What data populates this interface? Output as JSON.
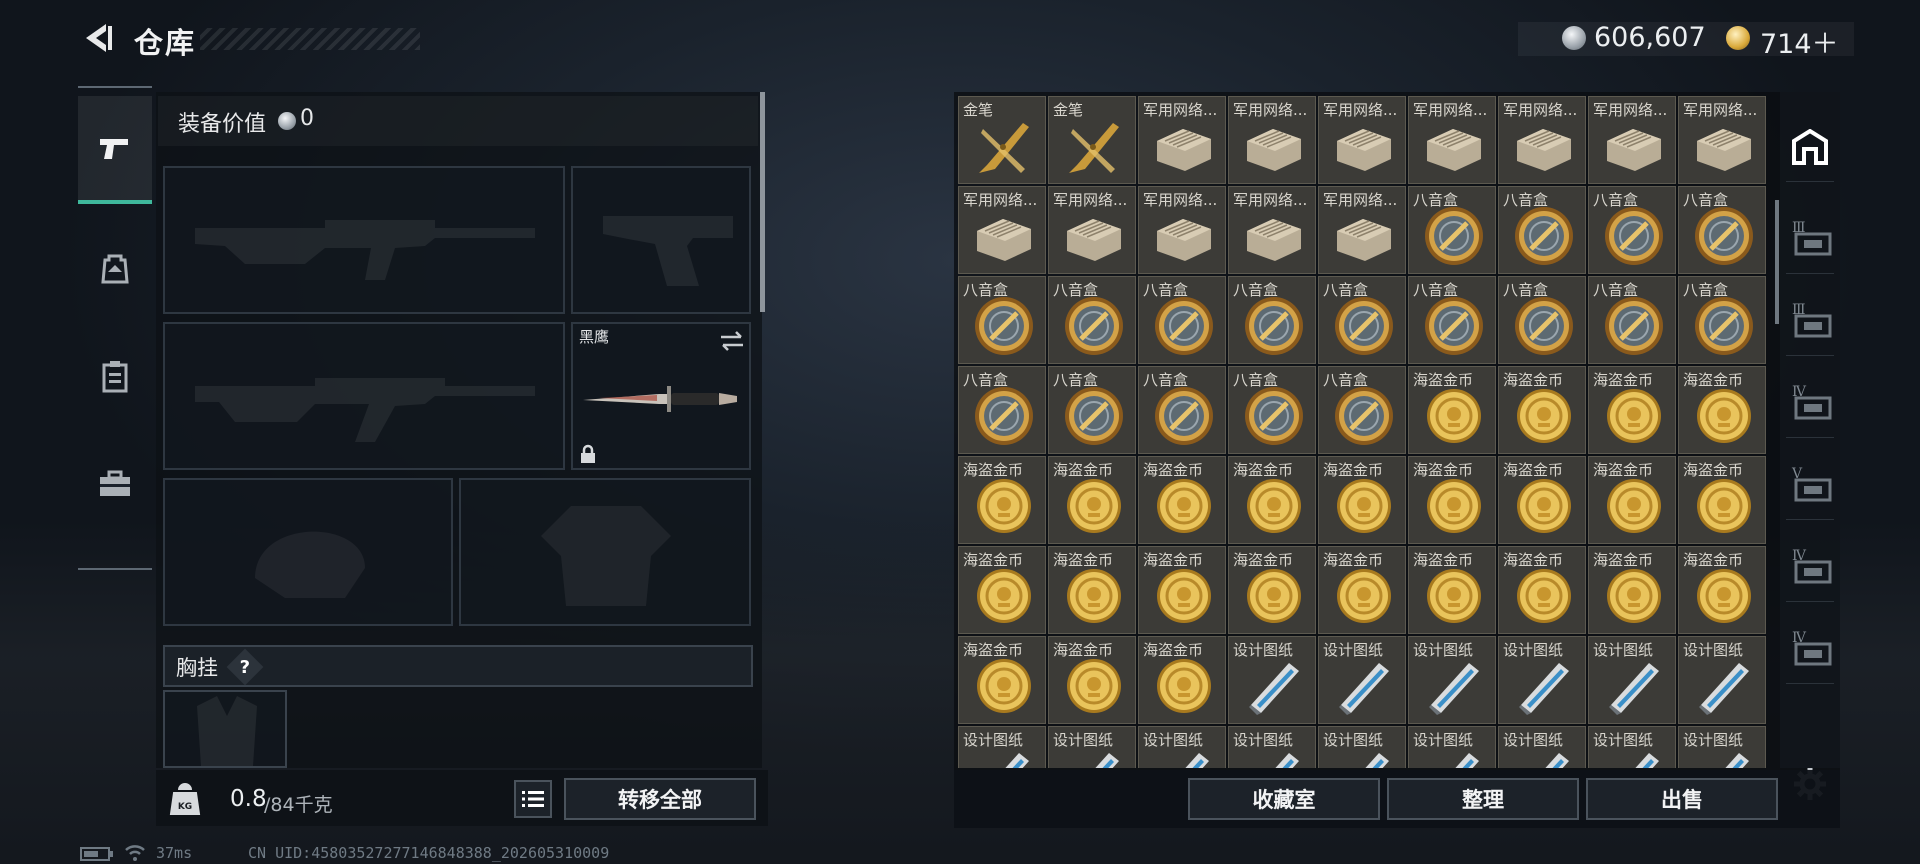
{
  "header": {
    "title": "仓库",
    "silver_amount": "606,607",
    "gold_amount": "714＋"
  },
  "equipment": {
    "value_label": "装备价值",
    "value": "0",
    "knife_name": "黑鹰",
    "chest_label": "胸挂",
    "help_glyph": "?"
  },
  "weight": {
    "current": "0.8",
    "max": "/84千克",
    "transfer_all": "转移全部"
  },
  "stash": {
    "items": [
      "金笔",
      "金笔",
      "军用网络...",
      "军用网络...",
      "军用网络...",
      "军用网络...",
      "军用网络...",
      "军用网络...",
      "军用网络...",
      "军用网络...",
      "军用网络...",
      "军用网络...",
      "军用网络...",
      "军用网络...",
      "八音盒",
      "八音盒",
      "八音盒",
      "八音盒",
      "八音盒",
      "八音盒",
      "八音盒",
      "八音盒",
      "八音盒",
      "八音盒",
      "八音盒",
      "八音盒",
      "八音盒",
      "八音盒",
      "八音盒",
      "八音盒",
      "八音盒",
      "八音盒",
      "海盗金币",
      "海盗金币",
      "海盗金币",
      "海盗金币",
      "海盗金币",
      "海盗金币",
      "海盗金币",
      "海盗金币",
      "海盗金币",
      "海盗金币",
      "海盗金币",
      "海盗金币",
      "海盗金币",
      "海盗金币",
      "海盗金币",
      "海盗金币",
      "海盗金币",
      "海盗金币",
      "海盗金币",
      "海盗金币",
      "海盗金币",
      "海盗金币",
      "海盗金币",
      "海盗金币",
      "海盗金币",
      "设计图纸",
      "设计图纸",
      "设计图纸",
      "设计图纸",
      "设计图纸",
      "设计图纸",
      "设计图纸",
      "设计图纸",
      "设计图纸",
      "设计图纸",
      "设计图纸",
      "设计图纸",
      "设计图纸",
      "设计图纸",
      "设计图纸"
    ],
    "buttons": {
      "collection": "收藏室",
      "organize": "整理",
      "sell": "出售"
    },
    "tabs": [
      "Ⅲ",
      "Ⅲ",
      "Ⅳ",
      "Ⅴ",
      "Ⅳ",
      "Ⅳ"
    ]
  },
  "status": {
    "ping": "37ms",
    "uid": "CN UID:4580352727714684838​8_202605310009"
  },
  "colors": {
    "accent": "#3fb89c",
    "gold": "#d9a93a",
    "silver": "#c9ced4"
  }
}
